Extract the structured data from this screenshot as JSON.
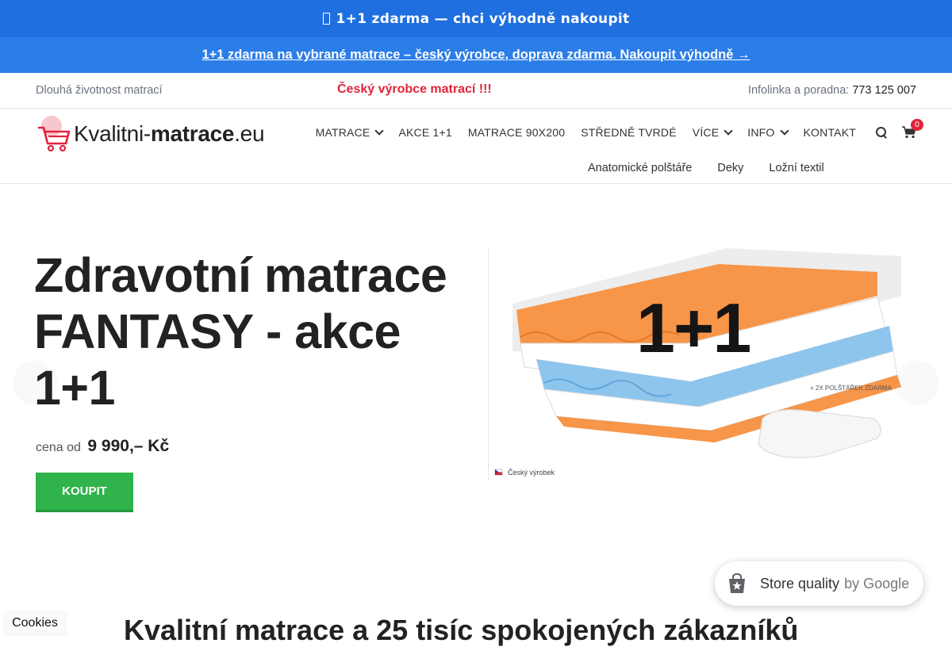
{
  "promo_bar": {
    "text": "1+1 zdarma — chci výhodně nakoupit"
  },
  "promo_link": {
    "text": "1+1 zdarma na vybrané matrace – český výrobce, doprava zdarma. Nakoupit výhodně →"
  },
  "topbar": {
    "left": "Dlouhá životnost matrací",
    "center": "Český výrobce matrací !!!",
    "helpline_label": "Infolinka a poradna:",
    "phone": "773 125 007"
  },
  "logo": {
    "prefix": "Kvalitni-",
    "bold": "matrace",
    "suffix": ".eu"
  },
  "nav": {
    "items": [
      {
        "label": "MATRACE",
        "dropdown": true
      },
      {
        "label": "AKCE 1+1",
        "dropdown": false
      },
      {
        "label": "MATRACE 90X200",
        "dropdown": false
      },
      {
        "label": "STŘEDNĚ TVRDÉ",
        "dropdown": false
      },
      {
        "label": "VÍCE",
        "dropdown": true
      },
      {
        "label": "INFO",
        "dropdown": true
      },
      {
        "label": "KONTAKT",
        "dropdown": false
      }
    ],
    "cart_count": "0"
  },
  "subnav": {
    "items": [
      "Anatomické polštáře",
      "Deky",
      "Ložní textil"
    ]
  },
  "hero": {
    "title": "Zdravotní matrace FANTASY - akce 1+1",
    "price_label": "cena od",
    "price_value": "9 990,– Kč",
    "buy_label": "KOUPIT"
  },
  "product_image": {
    "promo": "1+1",
    "pillow_note": "+ 2X POLŠTÁŘEK ZDARMA",
    "origin": "Český výrobek"
  },
  "google_badge": {
    "text": "Store quality",
    "suffix": "by Google"
  },
  "cookies": {
    "label": "Cookies"
  },
  "section": {
    "title": "Kvalitní matrace a 25 tisíc spokojených zákazníků"
  },
  "colors": {
    "promo_blue": "#1f6fe0",
    "accent_red": "#e0243c",
    "buy_green": "#2fb34a"
  }
}
